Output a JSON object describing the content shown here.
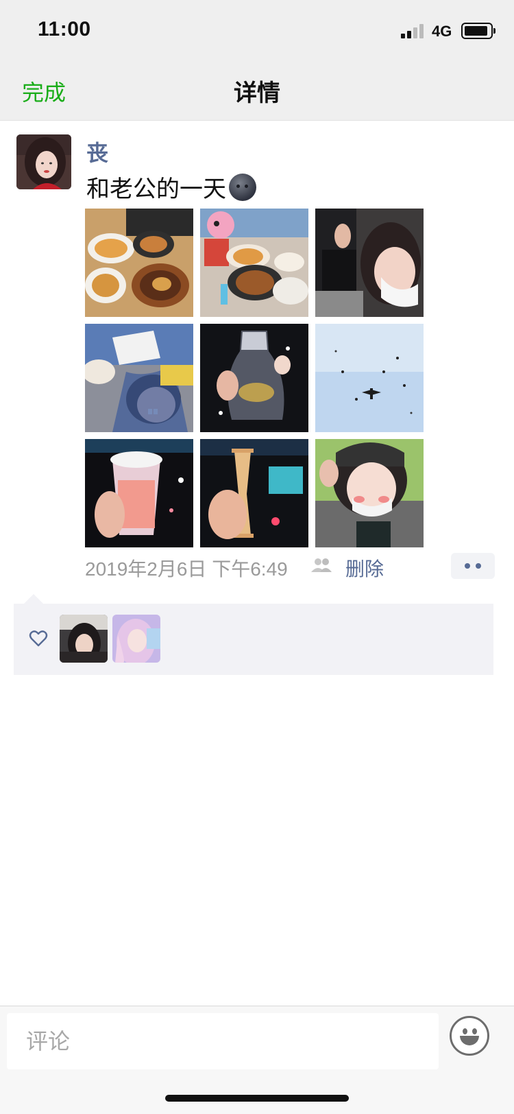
{
  "status_bar": {
    "time": "11:00",
    "network": "4G"
  },
  "nav": {
    "done_label": "完成",
    "title": "详情"
  },
  "post": {
    "username": "丧",
    "text": "和老公的一天",
    "text_emoji": "new-moon-face-emoji",
    "photo_count": 9,
    "timestamp": "2019年2月6日 下午6:49",
    "visibility_icon": "friends-icon",
    "delete_label": "删除",
    "more_icon": "more-dots-icon"
  },
  "likes": {
    "icon": "heart-icon",
    "avatar_count": 2
  },
  "comment": {
    "placeholder": "评论",
    "emoji_icon": "smiley-icon"
  },
  "colors": {
    "accent_green": "#1aad19",
    "link_blue": "#576b95",
    "bar_background": "#efefef",
    "likes_background": "#f2f2f6",
    "secondary_text": "#9a9a9a"
  }
}
